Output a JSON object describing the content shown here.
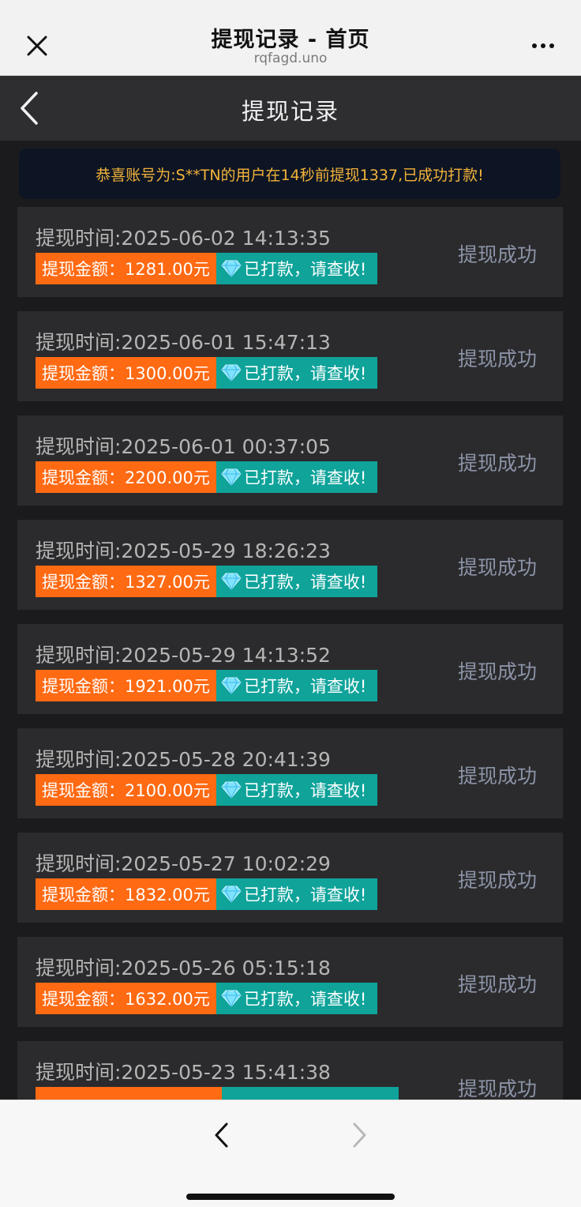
{
  "browser": {
    "title": "提现记录 - 首页",
    "url": "rqfagd.uno"
  },
  "header": {
    "title": "提现记录"
  },
  "notice": {
    "text": "恭喜账号为:S**TN的用户在14秒前提现1337,已成功打款!"
  },
  "records": [
    {
      "time": "提现时间:2025-06-02 14:13:35",
      "amount": "提现金额：1281.00元",
      "paid": "已打款，请查收!",
      "status": "提现成功"
    },
    {
      "time": "提现时间:2025-06-01 15:47:13",
      "amount": "提现金额：1300.00元",
      "paid": "已打款，请查收!",
      "status": "提现成功"
    },
    {
      "time": "提现时间:2025-06-01 00:37:05",
      "amount": "提现金额：2200.00元",
      "paid": "已打款，请查收!",
      "status": "提现成功"
    },
    {
      "time": "提现时间:2025-05-29 18:26:23",
      "amount": "提现金额：1327.00元",
      "paid": "已打款，请查收!",
      "status": "提现成功"
    },
    {
      "time": "提现时间:2025-05-29 14:13:52",
      "amount": "提现金额：1921.00元",
      "paid": "已打款，请查收!",
      "status": "提现成功"
    },
    {
      "time": "提现时间:2025-05-28 20:41:39",
      "amount": "提现金额：2100.00元",
      "paid": "已打款，请查收!",
      "status": "提现成功"
    },
    {
      "time": "提现时间:2025-05-27 10:02:29",
      "amount": "提现金额：1832.00元",
      "paid": "已打款，请查收!",
      "status": "提现成功"
    },
    {
      "time": "提现时间:2025-05-26 05:15:18",
      "amount": "提现金额：1632.00元",
      "paid": "已打款，请查收!",
      "status": "提现成功"
    },
    {
      "time": "提现时间:2025-05-23 15:41:38",
      "amount": "",
      "paid": "",
      "status": "提现成功"
    }
  ],
  "icons": {
    "close": "close-icon",
    "more": "more-icon",
    "back": "chevron-left-icon",
    "diamond": "diamond-icon",
    "nav_back": "chevron-left-icon",
    "nav_forward": "chevron-right-icon"
  },
  "colors": {
    "amount_badge": "#ff6a13",
    "paid_badge": "#0fa39a",
    "notice_text": "#f2b23a",
    "status_text": "#8b93a6"
  }
}
